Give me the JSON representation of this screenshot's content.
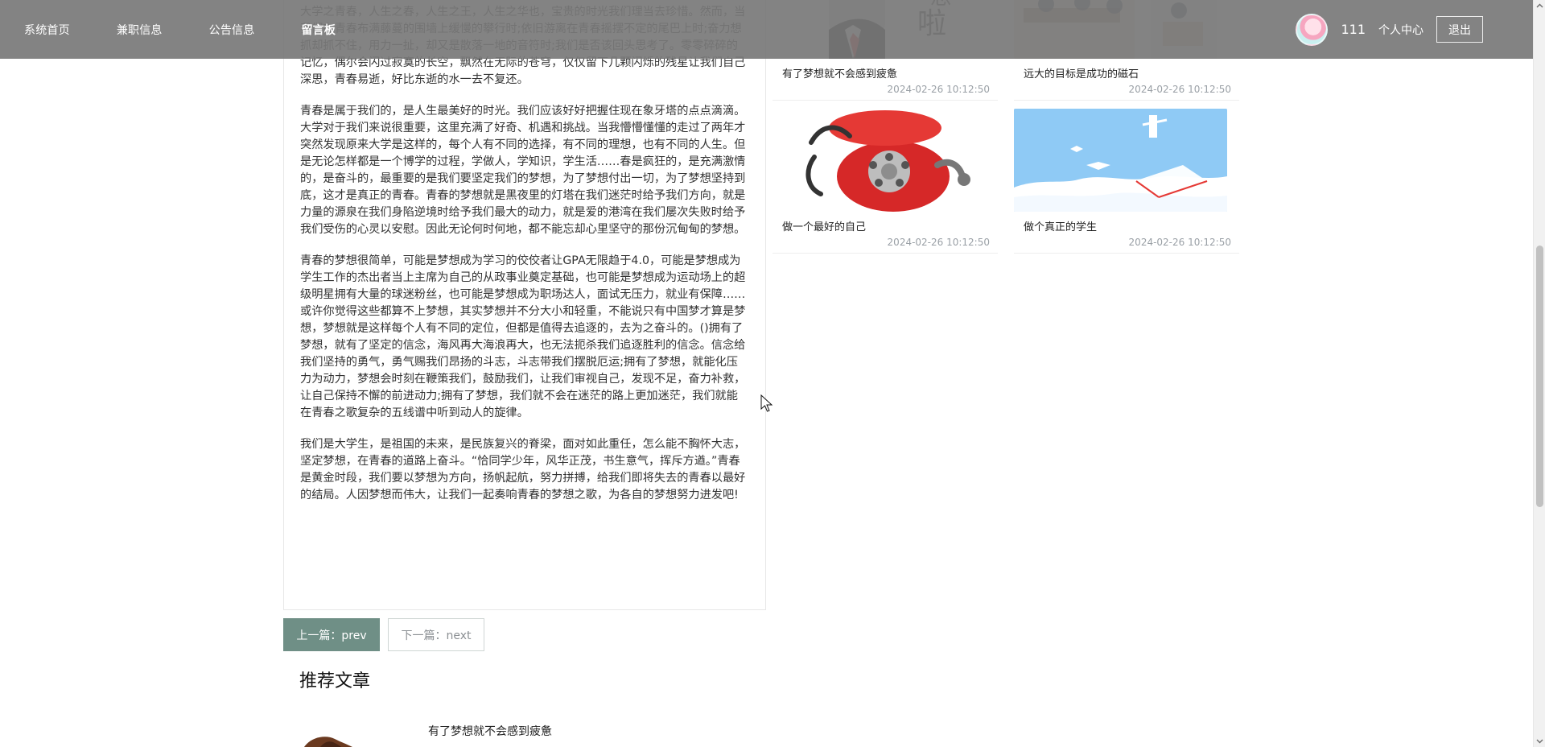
{
  "nav": {
    "items": [
      {
        "label": "系统首页"
      },
      {
        "label": "兼职信息"
      },
      {
        "label": "公告信息"
      },
      {
        "label": "留言板"
      }
    ]
  },
  "user": {
    "name": "111",
    "center_label": "个人中心",
    "logout_label": "退出"
  },
  "article": {
    "paragraphs": [
      "大学之青春，人生之春，人生之王，人生之华也，宝贵的时光我们理当去珍惜。然而，当我们在青春布满藤蔓的围墙上缓慢的攀行时;依旧游离在青春摇摆不定的尾巴上时;奋力想抓却抓不住，用力一扯，却又是散落一地的音符时;我们是否该回头思考了。零零碎碎的记忆，偶尔会闪过寂寞的长空，飘然在无际的苍穹，仅仅留下几颗闪烁的残星让我们自己深思，青春易逝，好比东逝的水一去不复还。",
      "青春是属于我们的，是人生最美好的时光。我们应该好好把握住现在象牙塔的点点滴滴。大学对于我们来说很重要，这里充满了好奇、机遇和挑战。当我懵懵懂懂的走过了两年才突然发现原来大学是这样的，每个人有不同的选择，有不同的理想，也有不同的人生。但是无论怎样都是一个博学的过程，学做人，学知识，学生活……春是疯狂的，是充满激情的，是奋斗的，最重要的是我们要坚定我们的梦想，为了梦想付出一切，为了梦想坚持到底，这才是真正的青春。青春的梦想就是黑夜里的灯塔在我们迷茫时给予我们方向，就是力量的源泉在我们身陷逆境时给予我们最大的动力，就是爱的港湾在我们屡次失败时给予我们受伤的心灵以安慰。因此无论何时何地，都不能忘却心里坚守的那份沉甸甸的梦想。",
      "青春的梦想很简单，可能是梦想成为学习的佼佼者让GPA无限趋于4.0，可能是梦想成为学生工作的杰出者当上主席为自己的从政事业奠定基础，也可能是梦想成为运动场上的超级明星拥有大量的球迷粉丝，也可能是梦想成为职场达人，面试无压力，就业有保障……或许你觉得这些都算不上梦想，其实梦想并不分大小和轻重，不能说只有中国梦才算是梦想，梦想就是这样每个人有不同的定位，但都是值得去追逐的，去为之奋斗的。()拥有了梦想，就有了坚定的信念，海风再大海浪再大，也无法扼杀我们追逐胜利的信念。信念给我们坚持的勇气，勇气赐我们昂扬的斗志，斗志带我们摆脱厄运;拥有了梦想，就能化压力为动力，梦想会时刻在鞭策我们，鼓励我们，让我们审视自己，发现不足，奋力补救，让自己保持不懈的前进动力;拥有了梦想，我们就不会在迷茫的路上更加迷茫，我们就能在青春之歌复杂的五线谱中听到动人的旋律。",
      "我们是大学生，是祖国的未来，是民族复兴的脊梁，面对如此重任，怎么能不胸怀大志，坚定梦想，在青春的道路上奋斗。“恰同学少年，风华正茂，书生意气，挥斥方遒。”青春是黄金时段，我们要以梦想为方向，扬帆起航，努力拼搏，给我们即将失去的青春以最好的结局。人因梦想而伟大，让我们一起奏响青春的梦想之歌，为各自的梦想努力进发吧!"
    ]
  },
  "pager": {
    "prev_label": "上一篇：prev",
    "next_label": "下一篇：next"
  },
  "recommend": {
    "title": "推荐文章",
    "first_item_title": "有了梦想就不会感到疲惫"
  },
  "side_cards": [
    {
      "title": "有了梦想就不会感到疲惫",
      "time": "2024-02-26 10:12:50"
    },
    {
      "title": "远大的目标是成功的磁石",
      "time": "2024-02-26 10:12:50"
    },
    {
      "title": "做一个最好的自己",
      "time": "2024-02-26 10:12:50"
    },
    {
      "title": "做个真正的学生",
      "time": "2024-02-26 10:12:50"
    }
  ],
  "colors": {
    "accent": "#6f8f86",
    "nav_bg": "#787878"
  }
}
